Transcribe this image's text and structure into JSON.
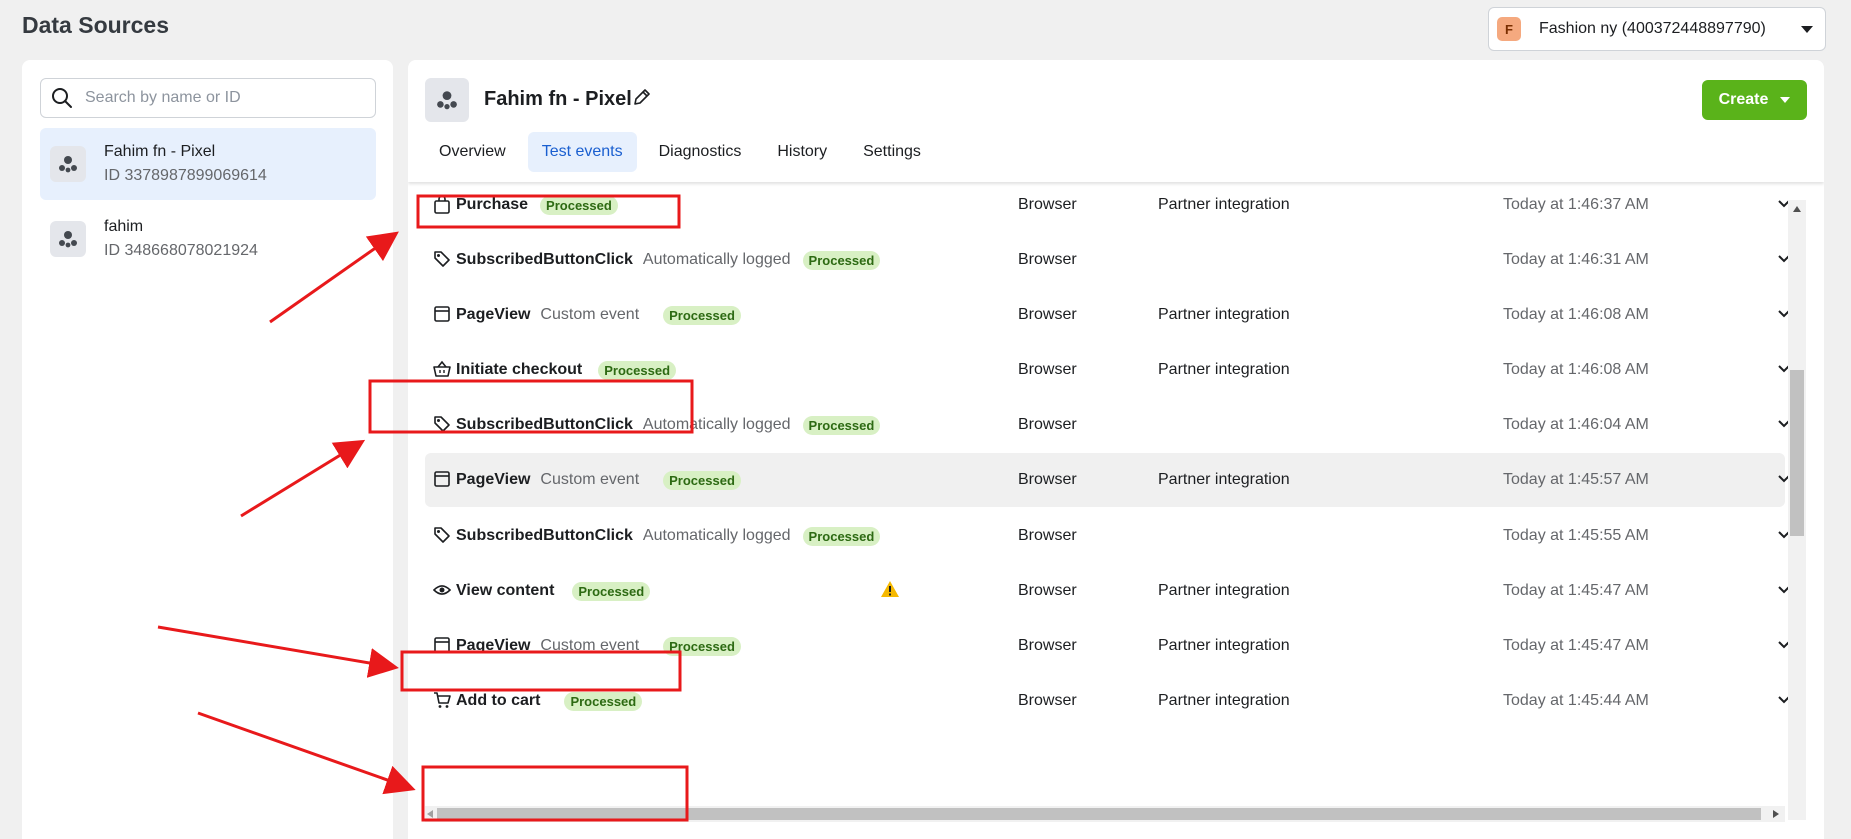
{
  "page_title": "Data Sources",
  "account": {
    "avatar_letter": "F",
    "name": "Fashion ny (400372448897790)"
  },
  "sidebar": {
    "search_placeholder": "Search by name or ID",
    "sources": [
      {
        "name": "Fahim fn - Pixel",
        "id": "ID 3378987899069614"
      },
      {
        "name": "fahim",
        "id": "ID 348668078021924"
      }
    ]
  },
  "main": {
    "pixel_title": "Fahim fn - Pixel",
    "create_label": "Create",
    "tabs": [
      "Overview",
      "Test events",
      "Diagnostics",
      "History",
      "Settings"
    ],
    "events": [
      {
        "name": "Purchase",
        "sub": "",
        "badge": "Processed",
        "source": "Browser",
        "integration": "Partner integration",
        "time": "Today at 1:46:37 AM",
        "icon": "shopping-bag-icon"
      },
      {
        "name": "SubscribedButtonClick",
        "sub": "Automatically logged",
        "badge": "Processed",
        "source": "Browser",
        "integration": "",
        "time": "Today at 1:46:31 AM",
        "icon": "tag-icon"
      },
      {
        "name": "PageView",
        "sub": "Custom event",
        "badge": "Processed",
        "source": "Browser",
        "integration": "Partner integration",
        "time": "Today at 1:46:08 AM",
        "icon": "browser-window-icon"
      },
      {
        "name": "Initiate checkout",
        "sub": "",
        "badge": "Processed",
        "source": "Browser",
        "integration": "Partner integration",
        "time": "Today at 1:46:08 AM",
        "icon": "basket-icon"
      },
      {
        "name": "SubscribedButtonClick",
        "sub": "Automatically logged",
        "badge": "Processed",
        "source": "Browser",
        "integration": "",
        "time": "Today at 1:46:04 AM",
        "icon": "tag-icon"
      },
      {
        "name": "PageView",
        "sub": "Custom event",
        "badge": "Processed",
        "source": "Browser",
        "integration": "Partner integration",
        "time": "Today at 1:45:57 AM",
        "icon": "browser-window-icon"
      },
      {
        "name": "SubscribedButtonClick",
        "sub": "Automatically logged",
        "badge": "Processed",
        "source": "Browser",
        "integration": "",
        "time": "Today at 1:45:55 AM",
        "icon": "tag-icon"
      },
      {
        "name": "View content",
        "sub": "",
        "badge": "Processed",
        "source": "Browser",
        "integration": "Partner integration",
        "time": "Today at 1:45:47 AM",
        "icon": "eye-icon"
      },
      {
        "name": "PageView",
        "sub": "Custom event",
        "badge": "Processed",
        "source": "Browser",
        "integration": "Partner integration",
        "time": "Today at 1:45:47 AM",
        "icon": "browser-window-icon"
      },
      {
        "name": "Add to cart",
        "sub": "",
        "badge": "Processed",
        "source": "Browser",
        "integration": "Partner integration",
        "time": "Today at 1:45:44 AM",
        "icon": "cart-icon"
      }
    ]
  },
  "colors": {
    "accent": "#1a5fd0",
    "create_button": "#5ab31a",
    "badge_bg": "#d8f0c4",
    "annotation": "#e8191b",
    "warning": "#f5b800"
  }
}
